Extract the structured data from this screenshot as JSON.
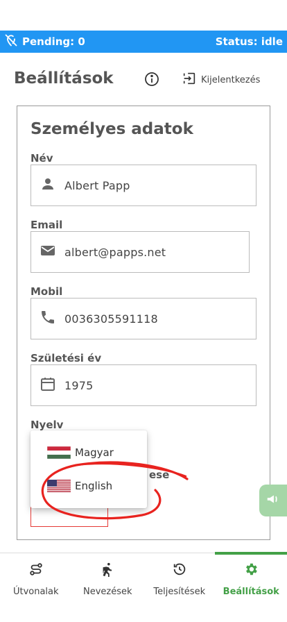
{
  "status_bar": {
    "pending": "Pending: 0",
    "status": "Status: idle",
    "color": "#2196f3"
  },
  "header": {
    "title": "Beállítások",
    "logout_label": "Kijelentkezés"
  },
  "card": {
    "title": "Személyes adatok",
    "fields": [
      {
        "label": "Név",
        "value": "Albert Papp",
        "icon": "person-icon"
      },
      {
        "label": "Email",
        "value": "albert@papps.net",
        "icon": "email-icon"
      },
      {
        "label": "Mobil",
        "value": "0036305591118",
        "icon": "phone-icon"
      },
      {
        "label": "Születési év",
        "value": "1975",
        "icon": "calendar-icon"
      }
    ],
    "language_label": "Nyelv",
    "partially_hidden_label": "ese"
  },
  "language_dropdown": {
    "options": [
      {
        "label": "Magyar",
        "flag": "hungary-flag"
      },
      {
        "label": "English",
        "flag": "usa-flag"
      }
    ]
  },
  "bottom_nav": {
    "items": [
      {
        "label": "Útvonalak",
        "icon": "route-icon"
      },
      {
        "label": "Nevezések",
        "icon": "runner-icon"
      },
      {
        "label": "Teljesítések",
        "icon": "history-icon"
      },
      {
        "label": "Beállítások",
        "icon": "gear-icon",
        "active": true
      }
    ],
    "active_color": "#43a047"
  }
}
